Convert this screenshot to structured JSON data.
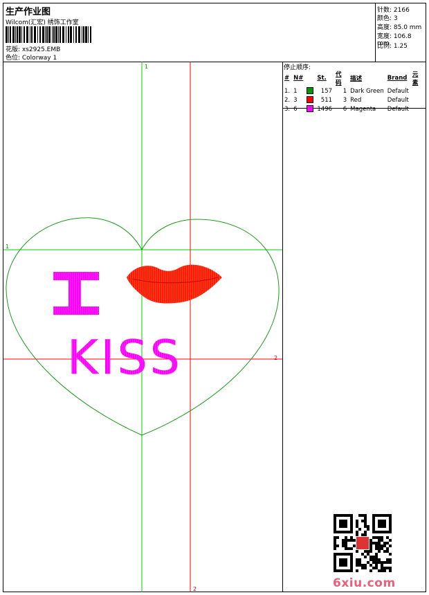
{
  "header": {
    "title": "生产作业图",
    "subtitle": "Wilcom(汇宏) 绣饰工作室",
    "design_label": "花版: xs2925.EMB",
    "colorway_label": "色位: Colorway 1"
  },
  "stats": {
    "stitches": "针数: 2166",
    "colors": "颜色: 3",
    "height": "高度: 85.0 mm",
    "width": "宽度: 106.8 mm",
    "scale": "比例: 1.25"
  },
  "canvas": {
    "guide_green_label_top": "1",
    "guide_green_label_left": "1",
    "guide_red_label_right": "2",
    "guide_red_label_bottom": "2",
    "word_i": "I",
    "word_kiss": "KISS",
    "colors": {
      "heart": "#1a9a1a",
      "lips": "#ff1a00",
      "text": "#ff00ff",
      "guide_green": "#00cc00",
      "guide_red": "#ff0000"
    }
  },
  "stop_sequence": {
    "title": "停止顺序:",
    "headers": [
      "#",
      "N#",
      "St.",
      "代码",
      "描述",
      "Brand",
      "元素"
    ],
    "rows": [
      {
        "idx": "1.",
        "n": "1",
        "st": "157",
        "code": "1",
        "desc": "Dark Green",
        "brand": "Default",
        "color": "#009900"
      },
      {
        "idx": "2.",
        "n": "3",
        "st": "511",
        "code": "3",
        "desc": "Red",
        "brand": "Default",
        "color": "#ff0000"
      },
      {
        "idx": "3.",
        "n": "6",
        "st": "1496",
        "code": "6",
        "desc": "Magenta",
        "brand": "Default",
        "color": "#ff00ff"
      }
    ]
  },
  "footer": {
    "brand": "6xiu.com"
  }
}
